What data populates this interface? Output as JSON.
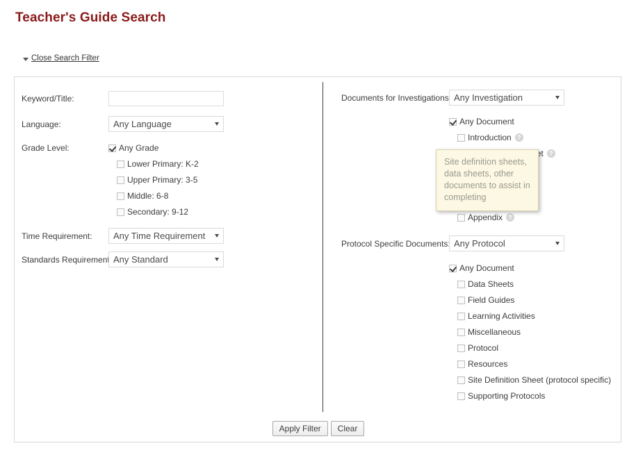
{
  "page": {
    "title": "Teacher's Guide Search",
    "filter_toggle_label": "Close Search Filter",
    "filter_toggle_icon": "triangle-down-icon"
  },
  "left_column": {
    "keyword": {
      "label": "Keyword/Title:",
      "value": "",
      "placeholder": ""
    },
    "language": {
      "label": "Language:",
      "selected": "Any Language"
    },
    "grade_level": {
      "label": "Grade Level:",
      "options": [
        {
          "label": "Any Grade",
          "checked": true,
          "indent": 0
        },
        {
          "label": "Lower Primary: K-2",
          "checked": false,
          "indent": 1
        },
        {
          "label": "Upper Primary: 3-5",
          "checked": false,
          "indent": 1
        },
        {
          "label": "Middle: 6-8",
          "checked": false,
          "indent": 1
        },
        {
          "label": "Secondary: 9-12",
          "checked": false,
          "indent": 1
        }
      ]
    },
    "time_requirement": {
      "label": "Time Requirement:",
      "selected": "Any Time Requirement"
    },
    "standards_requirement": {
      "label": "Standards Requirement:",
      "selected": "Any Standard"
    }
  },
  "right_column": {
    "investigations": {
      "label": "Documents for Investigations:",
      "selected": "Any Investigation",
      "options": [
        {
          "label": "Any Document",
          "checked": true,
          "indent": 0,
          "help": false
        },
        {
          "label": "Introduction",
          "checked": false,
          "indent": 1,
          "help": true
        },
        {
          "label": "Site Definition Sheet",
          "checked": false,
          "indent": 1,
          "help": true
        },
        {
          "label": "Appendix",
          "checked": false,
          "indent": 1,
          "help": true
        }
      ]
    },
    "protocol": {
      "label": "Protocol Specific Documents:",
      "selected": "Any Protocol",
      "options": [
        {
          "label": "Any Document",
          "checked": true,
          "indent": 0,
          "help": false
        },
        {
          "label": "Data Sheets",
          "checked": false,
          "indent": 1,
          "help": false
        },
        {
          "label": "Field Guides",
          "checked": false,
          "indent": 1,
          "help": false
        },
        {
          "label": "Learning Activities",
          "checked": false,
          "indent": 1,
          "help": false
        },
        {
          "label": "Miscellaneous",
          "checked": false,
          "indent": 1,
          "help": false
        },
        {
          "label": "Protocol",
          "checked": false,
          "indent": 1,
          "help": false
        },
        {
          "label": "Resources",
          "checked": false,
          "indent": 1,
          "help": false
        },
        {
          "label": "Site Definition Sheet (protocol specific)",
          "checked": false,
          "indent": 1,
          "help": false
        },
        {
          "label": "Supporting Protocols",
          "checked": false,
          "indent": 1,
          "help": false
        }
      ]
    }
  },
  "tooltip": {
    "text": "Site definition sheets, data sheets, other documents to assist in completing"
  },
  "buttons": {
    "apply": "Apply Filter",
    "clear": "Clear"
  },
  "help_icon_glyph": "?",
  "colors": {
    "title": "#8a1a1a",
    "tooltip_bg": "#fcf8e3",
    "panel_border": "#d8d8d8"
  }
}
